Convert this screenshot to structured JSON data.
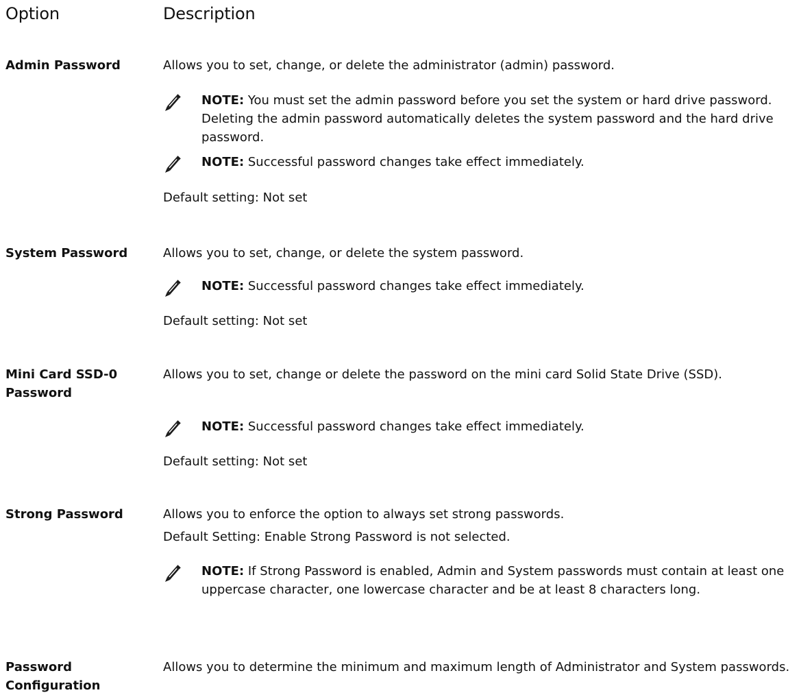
{
  "header": {
    "option": "Option",
    "description": "Description"
  },
  "note_label": "NOTE:",
  "rows": [
    {
      "option": "Admin Password",
      "description": "Allows you to set, change, or delete the administrator (admin) password.",
      "notes": [
        "You must set the admin password before you set the system or hard drive password. Deleting the admin password automatically deletes the system password and the hard drive password.",
        "Successful password changes take effect immediately."
      ],
      "default": "Default setting: Not set"
    },
    {
      "option": "System Password",
      "description": "Allows you to set, change, or delete the system password.",
      "notes": [
        "Successful password changes take effect immediately."
      ],
      "default": "Default setting: Not set"
    },
    {
      "option": "Mini Card SSD-0 Password",
      "description": "Allows you to set, change or delete the password on the mini card Solid State Drive (SSD).",
      "notes": [
        "Successful password changes take effect immediately."
      ],
      "default": "Default setting: Not set"
    },
    {
      "option": "Strong Password",
      "description": "Allows you to enforce the option to always set strong passwords.",
      "default": "Default Setting: Enable Strong Password is not selected.",
      "notes": [
        "If Strong Password is enabled, Admin and System passwords must contain at least one uppercase character, one lowercase character and be at least 8 characters long."
      ]
    },
    {
      "option": "Password Configuration",
      "description": "Allows you to determine the minimum and maximum length of Administrator and System passwords."
    }
  ],
  "icon": "note-pencil-icon"
}
